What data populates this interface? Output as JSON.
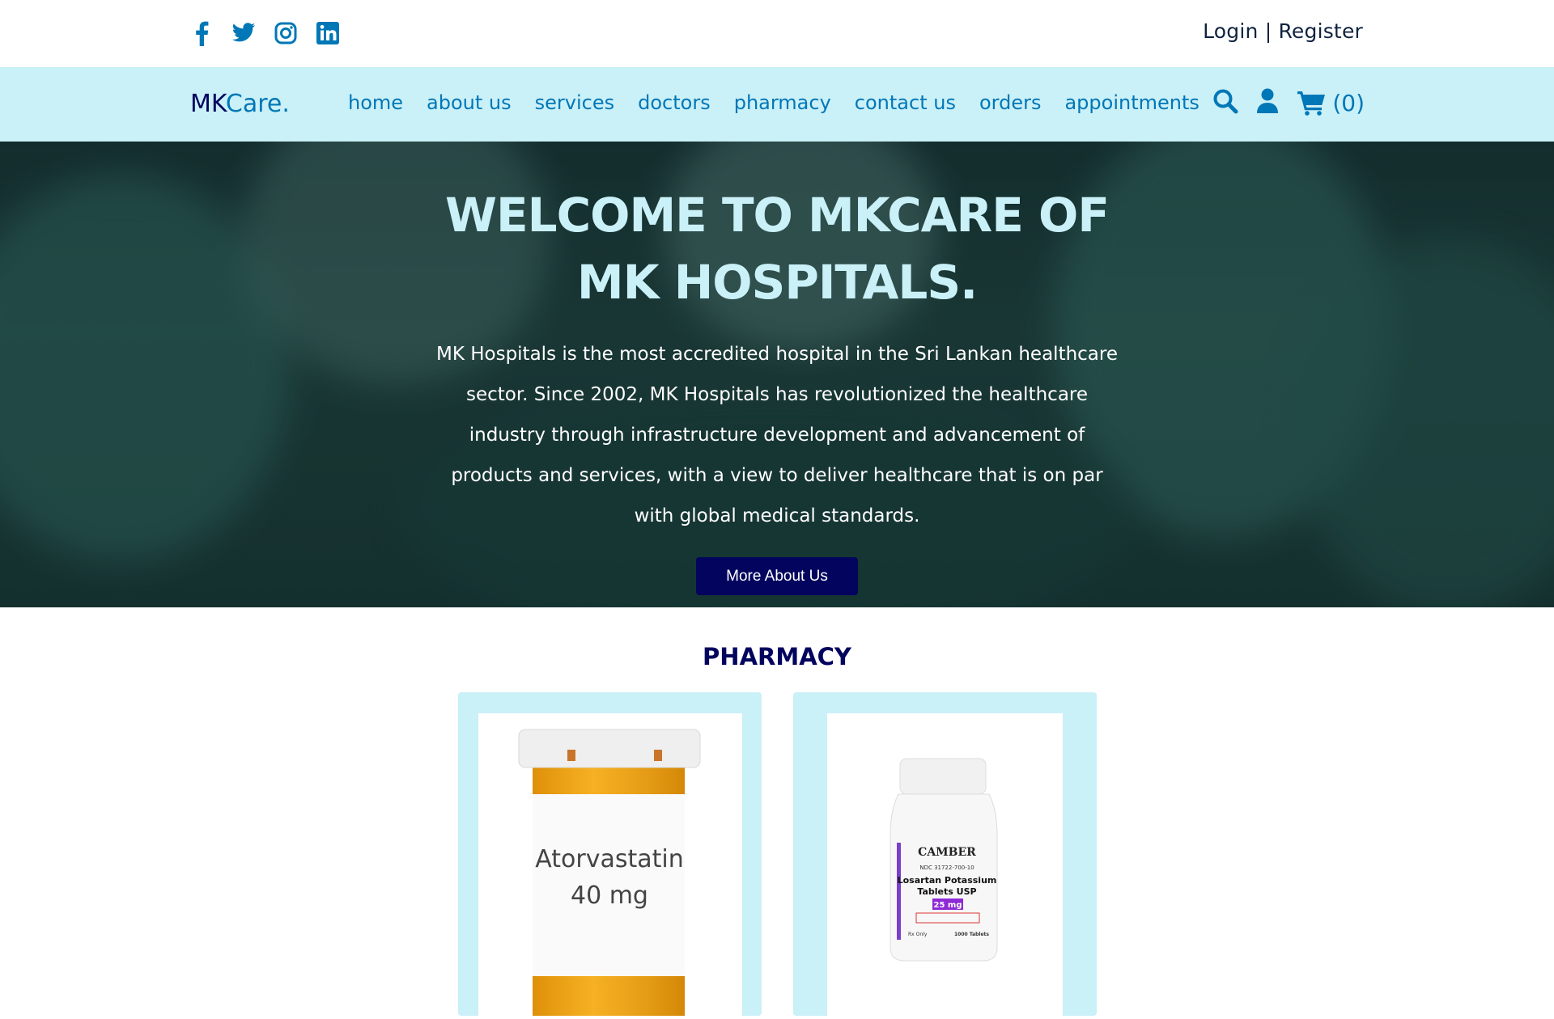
{
  "topbar": {
    "socials": [
      "facebook-icon",
      "twitter-icon",
      "instagram-icon",
      "linkedin-icon"
    ],
    "login_label": "Login",
    "separator": "|",
    "register_label": "Register"
  },
  "nav": {
    "brand_mk": "MK",
    "brand_care": "Care.",
    "links": [
      "home",
      "about us",
      "services",
      "doctors",
      "pharmacy",
      "contact us",
      "orders",
      "appointments"
    ],
    "cart_count": "(0)"
  },
  "hero": {
    "title": "WELCOME TO MKCARE OF MK HOSPITALS.",
    "text": "MK Hospitals is the most accredited hospital in the Sri Lankan healthcare sector. Since 2002, MK Hospitals has revolutionized the healthcare industry through infrastructure development and advancement of products and services, with a view to deliver healthcare that is on par with global medical standards.",
    "button_label": "More About Us"
  },
  "pharmacy": {
    "title": "PHARMACY",
    "products": [
      {
        "label_line1": "Atorvastatin",
        "label_line2": "40 mg"
      },
      {
        "brand": "CAMBER",
        "ndc": "NDC 31722-700-10",
        "name_line1": "Losartan Potassium",
        "name_line2": "Tablets USP",
        "dose": "25 mg",
        "rx": "Rx Only",
        "count": "1000 Tablets"
      }
    ]
  },
  "colors": {
    "navy": "#03045e",
    "blue": "#0077b6",
    "light": "#caf0f8"
  }
}
